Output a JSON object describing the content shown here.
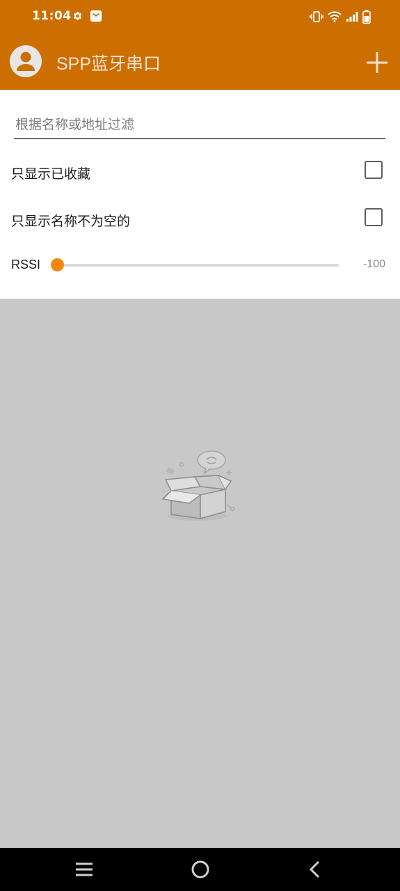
{
  "theme": {
    "primary": "#cc6f00",
    "accent": "#f6860f",
    "list_background": "#c8c8c8"
  },
  "status_bar": {
    "time": "11:04",
    "icons": [
      "settings-icon",
      "mail-icon",
      "vibrate-icon",
      "wifi-icon",
      "signal-icon",
      "battery-icon"
    ]
  },
  "app_bar": {
    "title": "SPP蓝牙串口",
    "icons": [
      "avatar-icon",
      "add-icon"
    ]
  },
  "filter": {
    "placeholder": "根据名称或地址过滤",
    "value": "",
    "only_favorites_label": "只显示已收藏",
    "only_favorites_checked": false,
    "only_named_label": "只显示名称不为空的",
    "only_named_checked": false,
    "rssi_label": "RSSI",
    "rssi_value": "-100",
    "rssi_fraction": 0
  },
  "empty_state": {
    "icon": "empty-box-icon"
  },
  "nav_bar": {
    "icons": [
      "menu-icon",
      "home-icon",
      "back-icon"
    ]
  }
}
